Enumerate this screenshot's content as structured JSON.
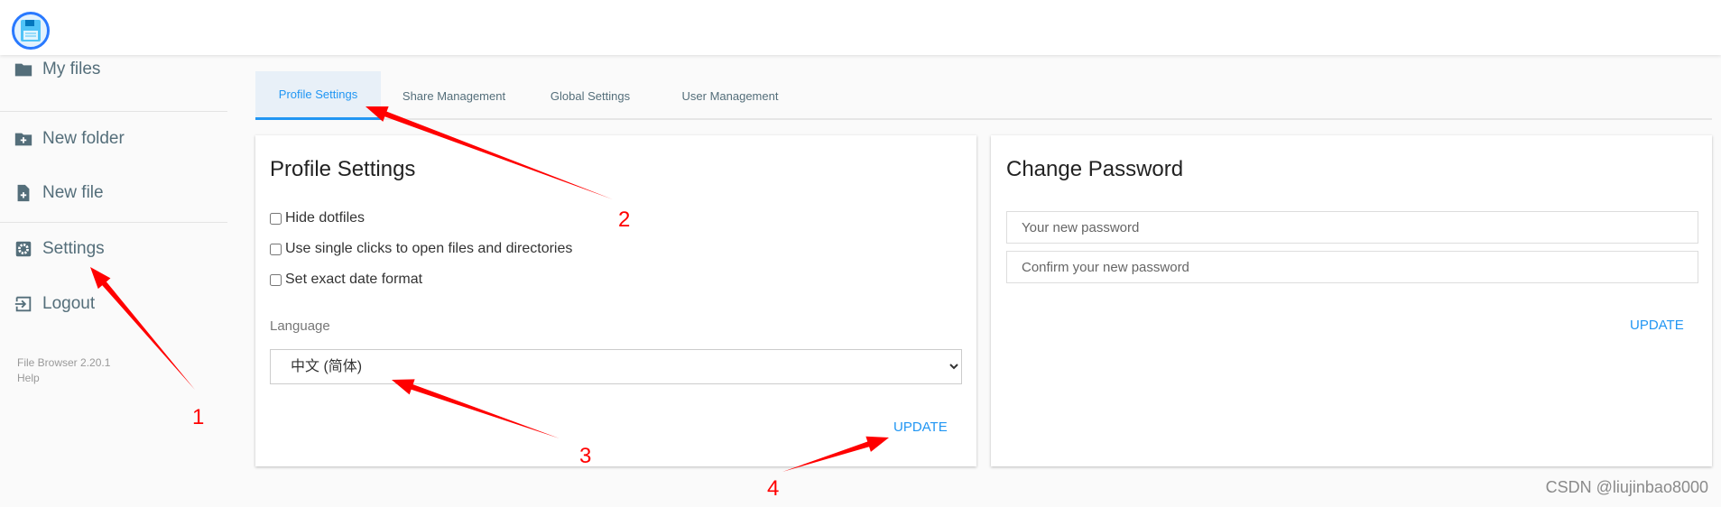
{
  "app": {
    "logo_icon": "floppy-disk-icon"
  },
  "sidebar": {
    "items": [
      {
        "label": "My files",
        "icon": "folder-icon"
      },
      {
        "label": "New folder",
        "icon": "folder-plus-icon"
      },
      {
        "label": "New file",
        "icon": "file-plus-icon"
      },
      {
        "label": "Settings",
        "icon": "gear-icon"
      },
      {
        "label": "Logout",
        "icon": "logout-icon"
      }
    ],
    "version": "File Browser 2.20.1",
    "help": "Help"
  },
  "tabs": [
    {
      "label": "Profile Settings",
      "active": true
    },
    {
      "label": "Share Management"
    },
    {
      "label": "Global Settings"
    },
    {
      "label": "User Management"
    }
  ],
  "profile": {
    "title": "Profile Settings",
    "checkboxes": [
      {
        "label": "Hide dotfiles",
        "checked": false
      },
      {
        "label": "Use single clicks to open files and directories",
        "checked": false
      },
      {
        "label": "Set exact date format",
        "checked": false
      }
    ],
    "language_label": "Language",
    "language_value": "中文 (简体)",
    "update": "UPDATE"
  },
  "password": {
    "title": "Change Password",
    "new_placeholder": "Your new password",
    "confirm_placeholder": "Confirm your new password",
    "update": "UPDATE"
  },
  "annotations": [
    "1",
    "2",
    "3",
    "4"
  ],
  "annotation_color": "#ff0000",
  "accent_color": "#2196f3",
  "watermark": "CSDN @liujinbao8000"
}
